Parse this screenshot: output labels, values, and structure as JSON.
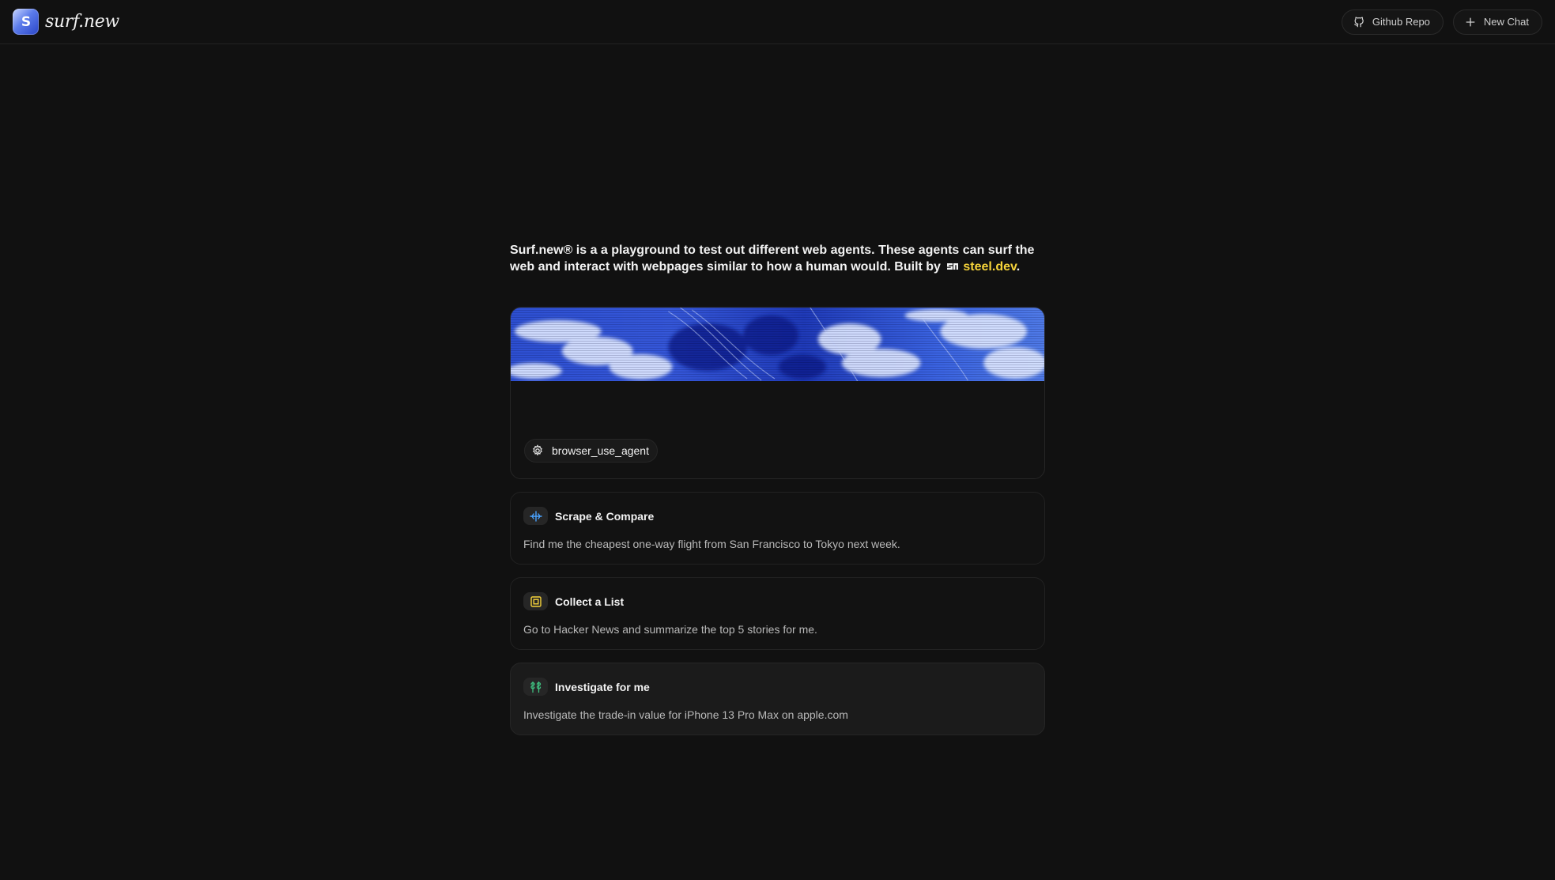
{
  "header": {
    "brand_logo_text": "S",
    "brand_name": "surf.new",
    "github_label": "Github Repo",
    "new_chat_label": "New Chat"
  },
  "intro": {
    "text": "Surf.new® is a a playground to test out different web agents. These agents can surf the web and interact with webpages similar to how a human would. Built by",
    "link": "steel.dev",
    "end": "."
  },
  "composer": {
    "agent_label": "browser_use_agent"
  },
  "suggestions": [
    {
      "title": "Scrape & Compare",
      "description": "Find me the cheapest one-way flight from San Francisco to Tokyo next week.",
      "icon": "crosshair-icon",
      "icon_color": "#4aa3ff"
    },
    {
      "title": "Collect a List",
      "description": "Go to Hacker News and summarize the top 5 stories for me.",
      "icon": "square-stack-icon",
      "icon_color": "#f5d33a"
    },
    {
      "title": "Investigate for me",
      "description": "Investigate the trade-in value for iPhone 13 Pro Max on apple.com",
      "icon": "dollar-icon",
      "icon_color": "#3fbf7f"
    }
  ],
  "colors": {
    "background": "#111111",
    "accent_link": "#f5d33a"
  }
}
